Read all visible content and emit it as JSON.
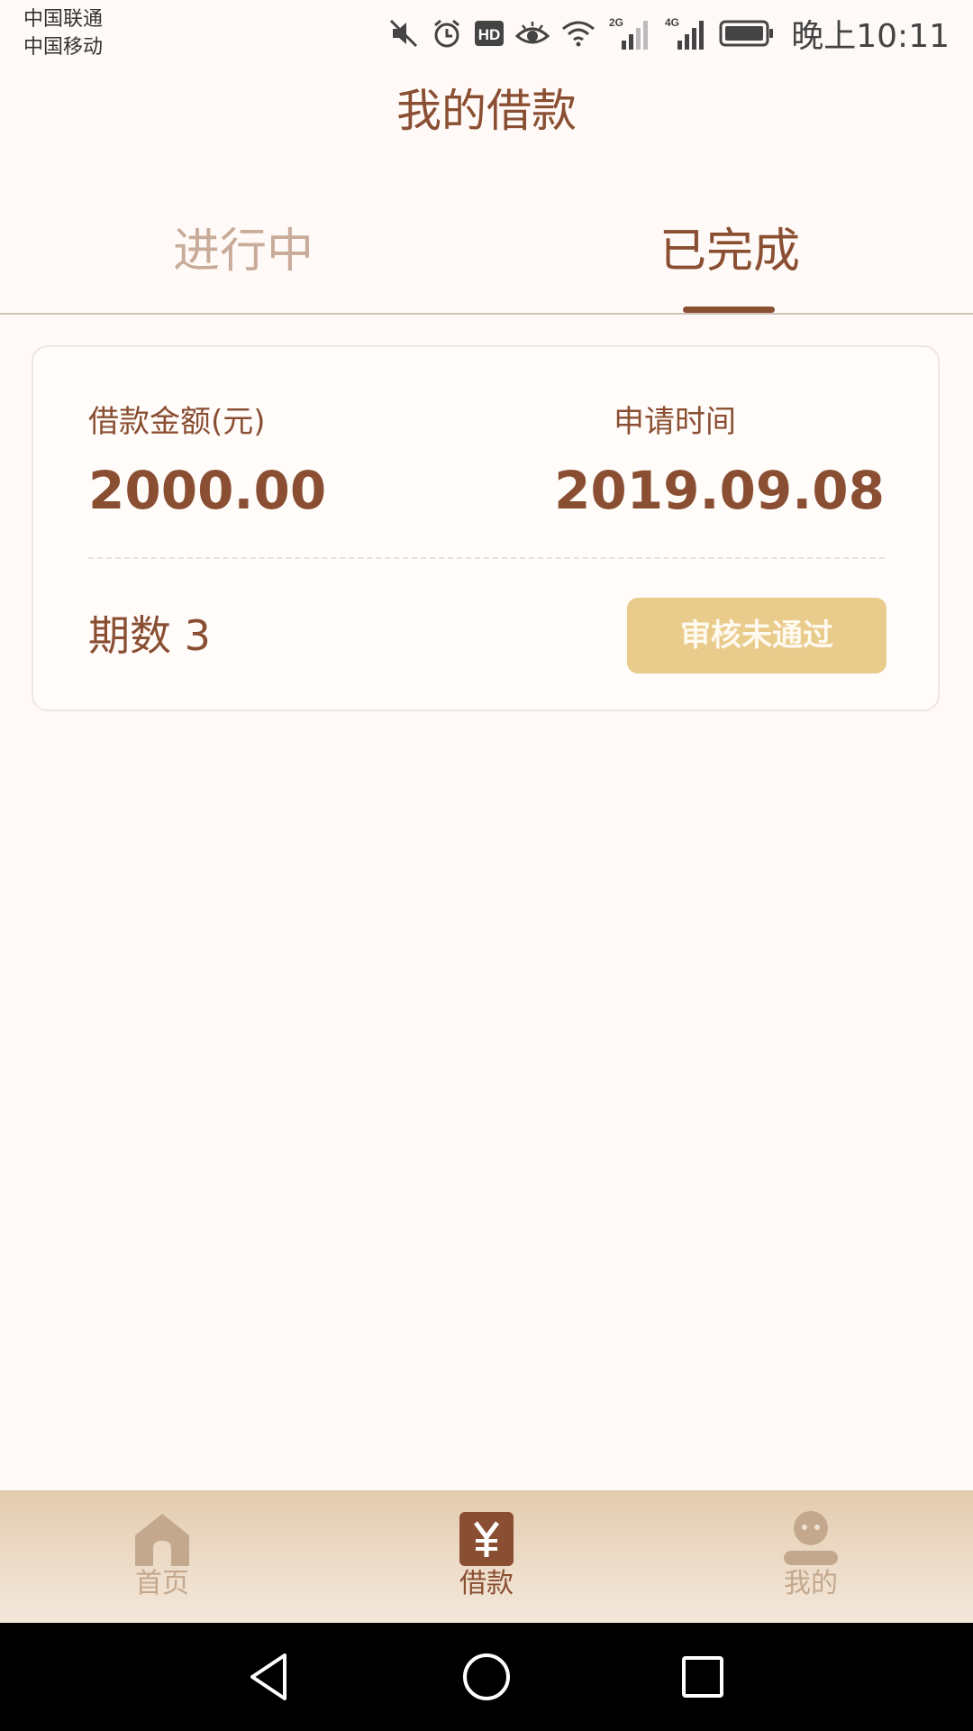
{
  "status_bar": {
    "carrier_1": "中国联通",
    "carrier_2": "中国移动",
    "network_1": "2G",
    "network_2": "4G",
    "hd_badge": "HD",
    "time": "晚上10:11",
    "icons": [
      "mute-icon",
      "alarm-icon",
      "hd-icon",
      "eye-icon",
      "wifi-icon",
      "signal-2g-icon",
      "signal-4g-icon",
      "battery-icon"
    ]
  },
  "header": {
    "title": "我的借款"
  },
  "tabs": [
    {
      "label": "进行中",
      "active": false
    },
    {
      "label": "已完成",
      "active": true
    }
  ],
  "loan_card": {
    "amount_label": "借款金额(元)",
    "amount_value": "2000.00",
    "date_label": "申请时间",
    "date_value": "2019.09.08",
    "period_text": "期数 3",
    "status_button": "审核未通过"
  },
  "bottom_nav": {
    "items": [
      {
        "label": "首页",
        "icon": "home-icon",
        "active": false
      },
      {
        "label": "借款",
        "icon": "yuan-icon",
        "active": true
      },
      {
        "label": "我的",
        "icon": "profile-icon",
        "active": false
      }
    ]
  },
  "colors": {
    "primary": "#8a4f32",
    "inactive": "#c9ab99",
    "background": "#fffaf7",
    "status_button": "#e9cb8c",
    "tab_bar_top": "#e3ccae",
    "tab_bar_bottom": "#f4e8dc"
  },
  "system_nav": {
    "icons": [
      "back-icon",
      "home-circle-icon",
      "recents-icon"
    ]
  }
}
